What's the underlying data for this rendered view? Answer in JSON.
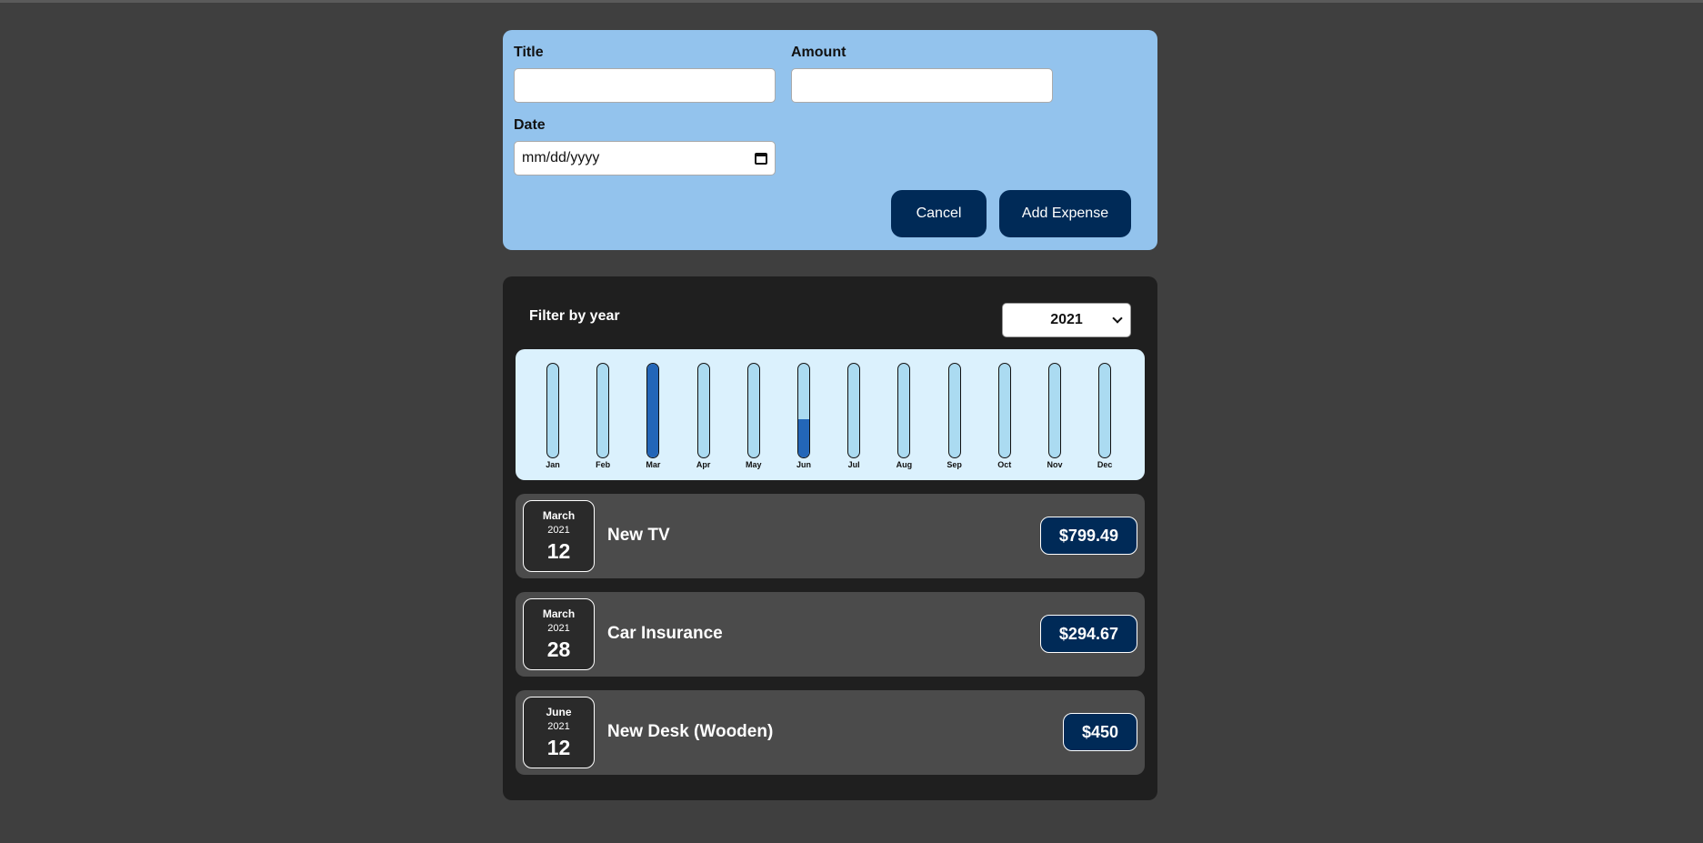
{
  "form": {
    "title_label": "Title",
    "title_value": "",
    "amount_label": "Amount",
    "amount_value": "",
    "date_label": "Date",
    "date_placeholder": "mm/dd/yyyy",
    "cancel_label": "Cancel",
    "add_label": "Add Expense",
    "icons": {
      "date": "calendar-icon"
    }
  },
  "filter": {
    "label": "Filter by year",
    "selected_year": "2021"
  },
  "chart_data": {
    "type": "bar",
    "categories": [
      "Jan",
      "Feb",
      "Mar",
      "Apr",
      "May",
      "Jun",
      "Jul",
      "Aug",
      "Sep",
      "Oct",
      "Nov",
      "Dec"
    ],
    "values": [
      0,
      0,
      1094.16,
      0,
      0,
      450,
      0,
      0,
      0,
      0,
      0,
      0
    ],
    "ylim": [
      0,
      1094.16
    ]
  },
  "expenses": [
    {
      "month": "March",
      "year": "2021",
      "day": "12",
      "title": "New TV",
      "amount": "$799.49"
    },
    {
      "month": "March",
      "year": "2021",
      "day": "28",
      "title": "Car Insurance",
      "amount": "$294.67"
    },
    {
      "month": "June",
      "year": "2021",
      "day": "12",
      "title": "New Desk (Wooden)",
      "amount": "$450"
    }
  ],
  "colors": {
    "background": "#3f3f3f",
    "form_bg": "#93c3ed",
    "button": "#002a57",
    "card_bg": "#1f1f1f",
    "chart_bg": "#dbf1fd",
    "bar_empty": "#abdbf1",
    "bar_fill": "#2366b8",
    "item_bg": "#4b4b4b"
  }
}
